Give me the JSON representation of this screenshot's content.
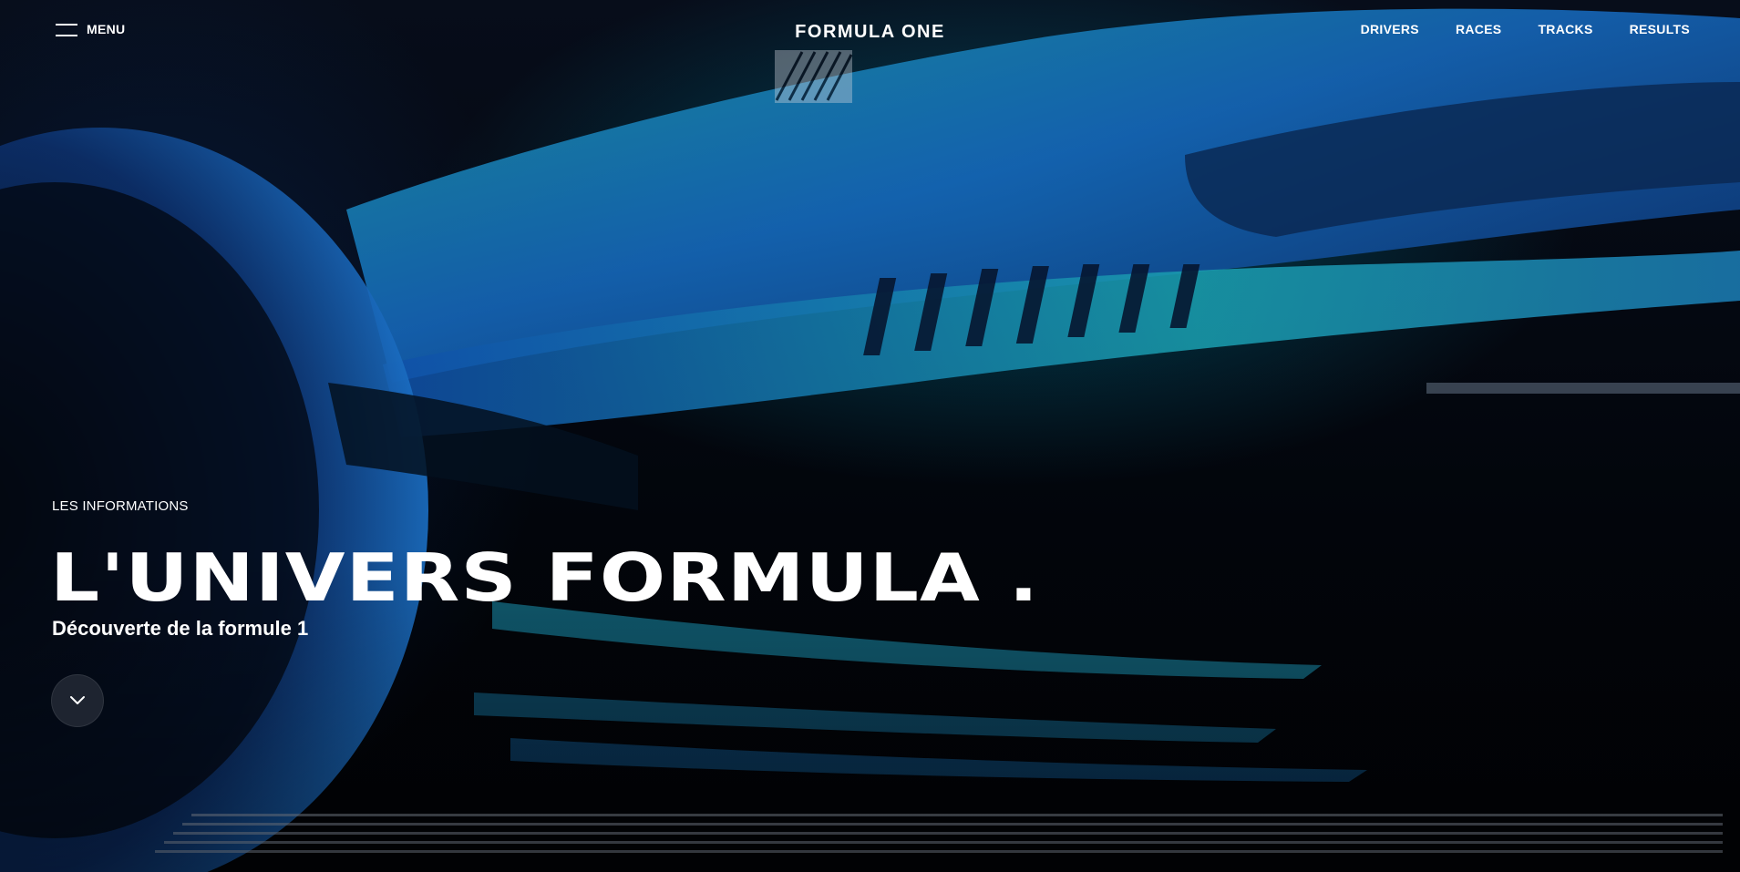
{
  "header": {
    "menu_label": "MENU",
    "brand": "FORMULA ONE",
    "nav": [
      {
        "label": "DRIVERS"
      },
      {
        "label": "RACES"
      },
      {
        "label": "TRACKS"
      },
      {
        "label": "RESULTS"
      }
    ]
  },
  "hero": {
    "kicker": "LES INFORMATIONS",
    "headline": "L'UNIVERS FORMULA .",
    "subtitle": "Découverte de la formule 1",
    "scroll_icon": "chevron-down-icon",
    "background_image": "formula-one-car-teal-blue-lighting"
  },
  "colors": {
    "background": "#03060d",
    "accent_teal": "#1fb3b3",
    "accent_blue": "#1456c8",
    "text": "#ffffff"
  }
}
